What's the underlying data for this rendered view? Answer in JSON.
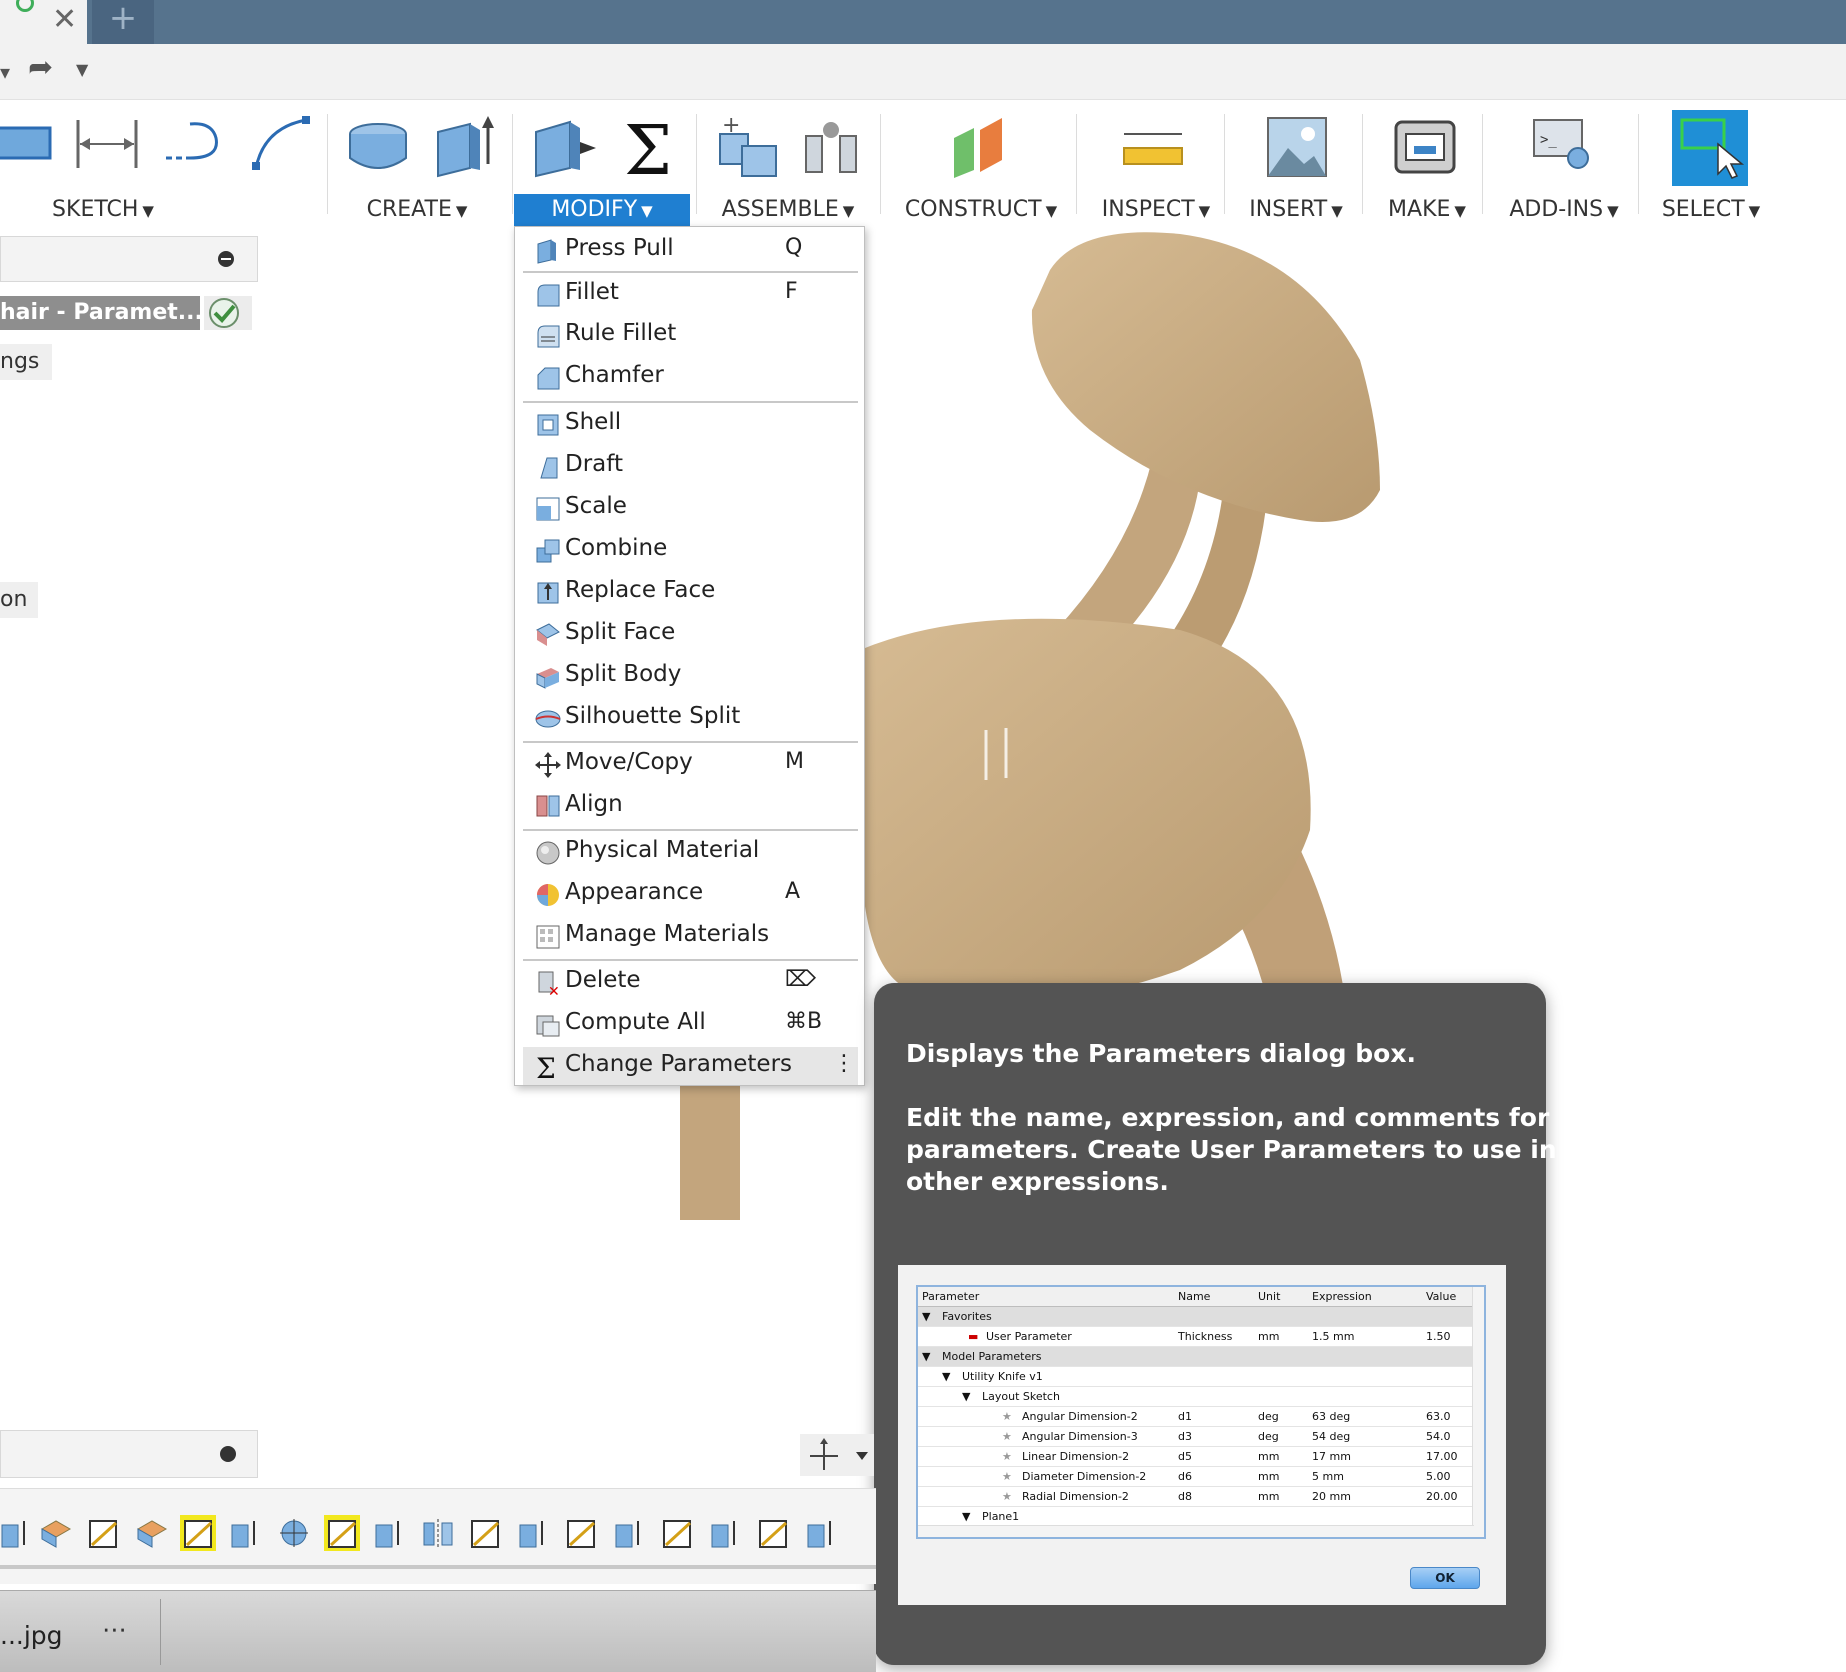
{
  "titlebar": {
    "close_glyph": "✕",
    "new_tab_glyph": "+"
  },
  "quick_access": {
    "redo_glyph": "➦",
    "dropdown_glyph": "▼"
  },
  "ribbon": {
    "groups": [
      {
        "label": "SKETCH",
        "arrow": "▼"
      },
      {
        "label": "CREATE",
        "arrow": "▼"
      },
      {
        "label": "MODIFY",
        "arrow": "▼"
      },
      {
        "label": "ASSEMBLE",
        "arrow": "▼"
      },
      {
        "label": "CONSTRUCT",
        "arrow": "▼"
      },
      {
        "label": "INSPECT",
        "arrow": "▼"
      },
      {
        "label": "INSERT",
        "arrow": "▼"
      },
      {
        "label": "MAKE",
        "arrow": "▼"
      },
      {
        "label": "ADD-INS",
        "arrow": "▼"
      },
      {
        "label": "SELECT",
        "arrow": "▼"
      }
    ],
    "accent": "#1f7fd1"
  },
  "browser": {
    "document_name": "hair - Paramet...",
    "items": [
      "ngs",
      "on"
    ]
  },
  "modify_menu": {
    "items": [
      {
        "label": "Press Pull",
        "key": "Q",
        "icon": "press-pull-icon"
      },
      {
        "label": "Fillet",
        "key": "F",
        "icon": "fillet-icon"
      },
      {
        "label": "Rule Fillet",
        "key": "",
        "icon": "rule-fillet-icon"
      },
      {
        "label": "Chamfer",
        "key": "",
        "icon": "chamfer-icon"
      },
      {
        "label": "Shell",
        "key": "",
        "icon": "shell-icon"
      },
      {
        "label": "Draft",
        "key": "",
        "icon": "draft-icon"
      },
      {
        "label": "Scale",
        "key": "",
        "icon": "scale-icon"
      },
      {
        "label": "Combine",
        "key": "",
        "icon": "combine-icon"
      },
      {
        "label": "Replace Face",
        "key": "",
        "icon": "replace-face-icon"
      },
      {
        "label": "Split Face",
        "key": "",
        "icon": "split-face-icon"
      },
      {
        "label": "Split Body",
        "key": "",
        "icon": "split-body-icon"
      },
      {
        "label": "Silhouette Split",
        "key": "",
        "icon": "silhouette-split-icon"
      },
      {
        "label": "Move/Copy",
        "key": "M",
        "icon": "move-copy-icon"
      },
      {
        "label": "Align",
        "key": "",
        "icon": "align-icon"
      },
      {
        "label": "Physical Material",
        "key": "",
        "icon": "physical-material-icon"
      },
      {
        "label": "Appearance",
        "key": "A",
        "icon": "appearance-icon"
      },
      {
        "label": "Manage Materials",
        "key": "",
        "icon": "manage-materials-icon"
      },
      {
        "label": "Delete",
        "key": "⌦",
        "icon": "delete-icon"
      },
      {
        "label": "Compute All",
        "key": "⌘B",
        "icon": "compute-all-icon"
      },
      {
        "label": "Change Parameters",
        "key": "⋮",
        "icon": "sigma-icon"
      }
    ]
  },
  "tooltip": {
    "line1": "Displays the Parameters dialog box.",
    "line2": "Edit the name, expression, and comments for",
    "line3": "parameters. Create User Parameters to use in",
    "line4": "other expressions.",
    "preview": {
      "headers": [
        "Parameter",
        "Name",
        "Unit",
        "Expression",
        "Value"
      ],
      "favorites": "Favorites",
      "user_param": [
        "User Parameter",
        "Thickness",
        "mm",
        "1.5 mm",
        "1.50"
      ],
      "model_params": "Model Parameters",
      "component": "Utility Knife v1",
      "sketch": "Layout Sketch",
      "rows": [
        [
          "Angular Dimension-2",
          "d1",
          "deg",
          "63 deg",
          "63.0"
        ],
        [
          "Angular Dimension-3",
          "d3",
          "deg",
          "54 deg",
          "54.0"
        ],
        [
          "Linear Dimension-2",
          "d5",
          "mm",
          "17 mm",
          "17.00"
        ],
        [
          "Diameter Dimension-2",
          "d6",
          "mm",
          "5 mm",
          "5.00"
        ],
        [
          "Radial Dimension-2",
          "d8",
          "mm",
          "20 mm",
          "20.00"
        ]
      ],
      "plane": "Plane1",
      "ok": "OK"
    }
  },
  "taskbar": {
    "file": "...jpg",
    "more": "⋯"
  }
}
